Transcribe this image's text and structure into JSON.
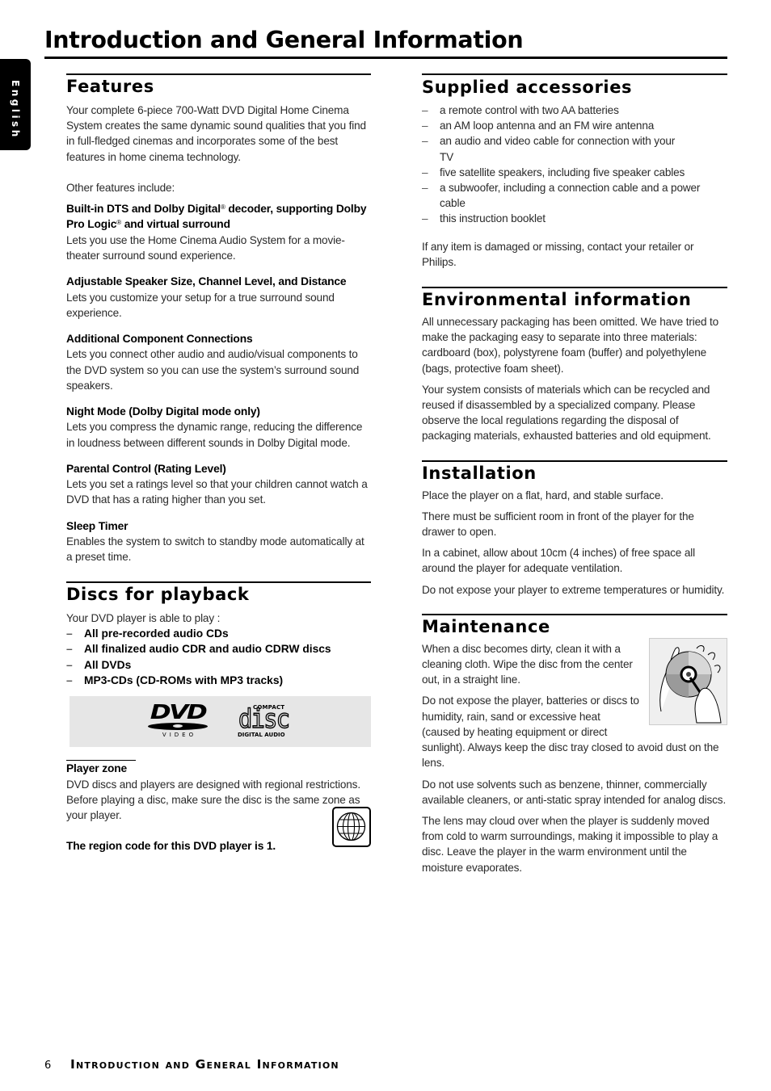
{
  "page": {
    "title": "Introduction and General Information",
    "language_tab": "English",
    "footer": {
      "page_number": "6",
      "title": "Introduction and General Information"
    }
  },
  "features": {
    "heading": "Features",
    "intro": "Your complete 6-piece 700-Watt DVD Digital Home Cinema System creates the same dynamic sound qualities that you find in full-fledged cinemas and incorporates some of the best features in home cinema technology.",
    "other_label": "Other features include:",
    "items": [
      {
        "title_parts": [
          "Built-in DTS and Dolby Digital",
          "®",
          " decoder, supporting Dolby Pro Logic",
          "®",
          " and virtual surround"
        ],
        "text": "Lets you use the Home Cinema Audio System for a movie-theater surround sound experience."
      },
      {
        "title": "Adjustable Speaker Size, Channel Level, and Distance",
        "text": "Lets you customize your setup for a true surround sound experience."
      },
      {
        "title": "Additional Component Connections",
        "text": "Lets you connect other audio and audio/visual components to the DVD system so you can use the system’s surround sound speakers."
      },
      {
        "title": "Night Mode (Dolby Digital mode only)",
        "text": "Lets you compress the dynamic range, reducing the difference in loudness between different sounds in Dolby Digital mode."
      },
      {
        "title": "Parental Control (Rating Level)",
        "text": "Lets you set a ratings level so that your children cannot watch a DVD that has a rating higher than you set."
      },
      {
        "title": "Sleep Timer",
        "text": "Enables the system to switch to standby mode automatically at a preset time."
      }
    ]
  },
  "discs": {
    "heading": "Discs for playback",
    "intro": "Your DVD player is able to play :",
    "items": [
      "All pre-recorded audio CDs",
      "All finalized audio CDR and audio CDRW discs",
      "All DVDs",
      "MP3-CDs (CD-ROMs with MP3 tracks)"
    ],
    "logos": {
      "dvd": {
        "word": "DVD",
        "sub": "VIDEO"
      },
      "cd": {
        "top": "COMPACT",
        "word": "disc",
        "bottom": "DIGITAL AUDIO"
      }
    },
    "player_zone": {
      "title": "Player zone",
      "text": "DVD discs and players are designed with regional restrictions. Before playing a disc, make sure the disc is the same zone as your player.",
      "region_note": "The region code for this DVD player is 1."
    }
  },
  "accessories": {
    "heading": "Supplied accessories",
    "items": [
      "a remote control with two AA batteries",
      "an AM loop antenna and an FM wire antenna",
      "an audio and video cable for connection with your TV",
      "five satellite speakers, including five speaker cables",
      "a subwoofer, including a connection cable and a power cable",
      "this instruction booklet"
    ],
    "note": "If any item is damaged or missing, contact your retailer or Philips."
  },
  "environment": {
    "heading": "Environmental information",
    "paragraphs": [
      "All unnecessary packaging has been omitted.  We have tried to make the packaging easy to separate into three materials: cardboard (box), polystyrene foam (buffer) and polyethylene (bags, protective foam sheet).",
      "Your system consists of materials which can be recycled and reused if disassembled by a specialized company. Please observe the local regulations regarding the disposal of packaging materials, exhausted batteries and old equipment."
    ]
  },
  "installation": {
    "heading": "Installation",
    "paragraphs": [
      "Place the player on a flat, hard, and stable surface.",
      "There must be sufficient room in front of the player for the drawer to open.",
      "In a cabinet, allow about 10cm (4 inches) of free space all around the player for adequate ventilation.",
      "Do not expose your player to extreme temperatures or humidity."
    ]
  },
  "maintenance": {
    "heading": "Maintenance",
    "paragraphs": [
      "When a disc becomes dirty, clean it with a cleaning cloth. Wipe the disc from the center out, in a straight line.",
      "Do not expose the player, batteries or discs to humidity, rain, sand or excessive heat (caused by heating equipment or direct sunlight).  Always keep the disc tray closed to avoid dust on the lens.",
      "Do not use solvents such as benzene, thinner, commercially available cleaners, or anti-static spray intended for analog discs.",
      "The lens may cloud over when the player is suddenly moved from cold to warm surroundings, making it impossible to play a disc. Leave the player in the warm environment until the moisture evaporates."
    ]
  }
}
